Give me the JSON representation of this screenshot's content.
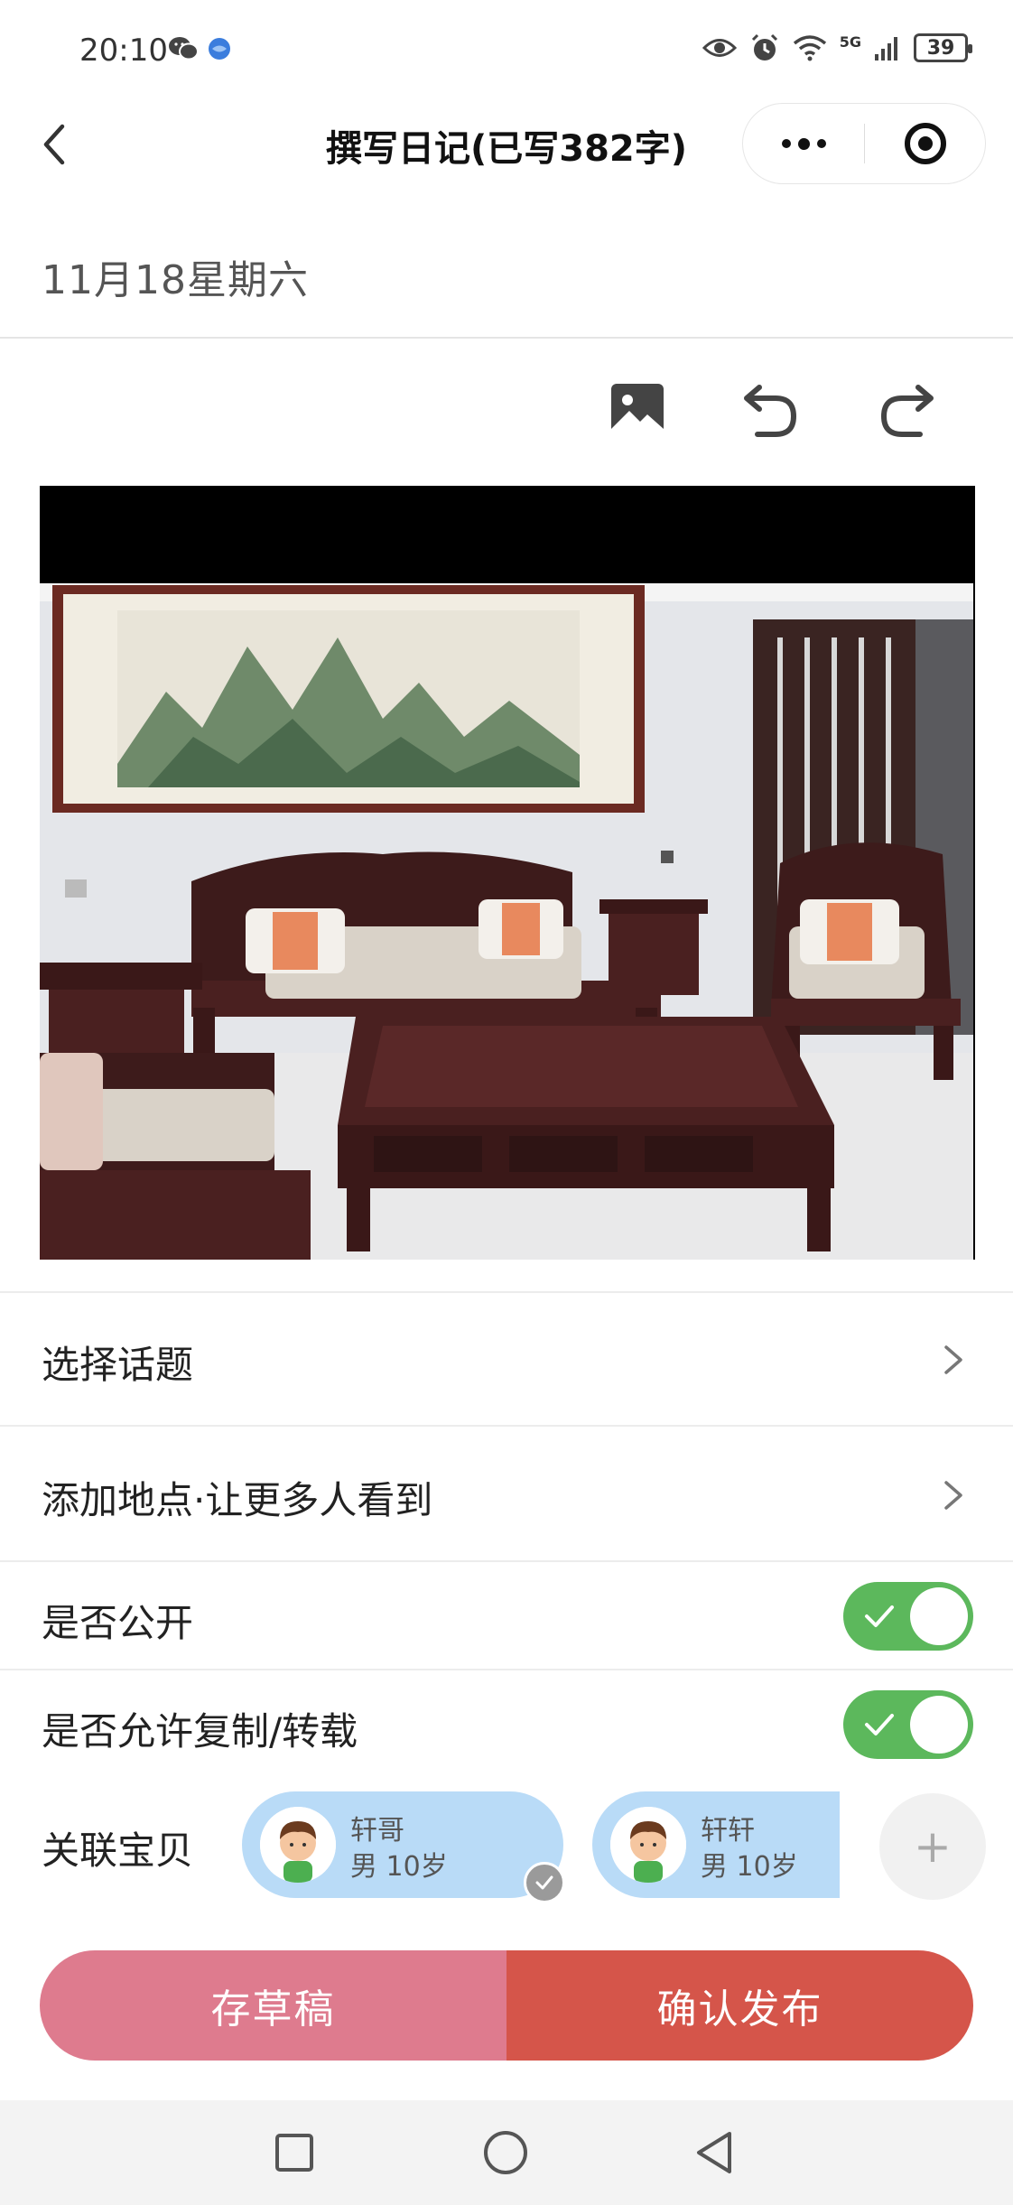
{
  "status_bar": {
    "time": "20:10",
    "network": "5G",
    "battery": "39"
  },
  "nav": {
    "title": "撰写日记(已写382字)"
  },
  "date": "11月18星期六",
  "rows": {
    "topic": "选择话题",
    "location": "添加地点·让更多人看到",
    "public": "是否公开",
    "allow_copy": "是否允许复制/转载"
  },
  "toggles": {
    "public_on": true,
    "allow_copy_on": true
  },
  "babies": {
    "label": "关联宝贝",
    "items": [
      {
        "name": "轩哥",
        "info": "男  10岁",
        "selected": true
      },
      {
        "name": "轩轩",
        "info": "男  10岁",
        "selected": false
      }
    ],
    "add": "+"
  },
  "buttons": {
    "draft": "存草稿",
    "publish": "确认发布"
  },
  "colors": {
    "toggle_on": "#5cb85c",
    "chip_bg": "#b9dbf7",
    "draft_button": "#de7b8e",
    "publish_button": "#d5554a"
  }
}
